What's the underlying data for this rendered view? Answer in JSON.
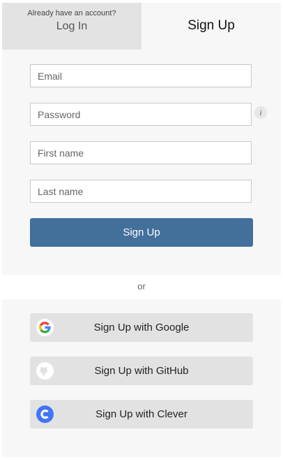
{
  "tabs": {
    "login_prompt": "Already have an account?",
    "login": "Log In",
    "signup": "Sign Up"
  },
  "form": {
    "email_placeholder": "Email",
    "password_placeholder": "Password",
    "first_name_placeholder": "First name",
    "last_name_placeholder": "Last name",
    "info_icon": "i",
    "submit": "Sign Up"
  },
  "divider": "or",
  "social": [
    {
      "label": "Sign Up with Google",
      "icon": "google-icon"
    },
    {
      "label": "Sign Up with GitHub",
      "icon": "github-icon"
    },
    {
      "label": "Sign Up with Clever",
      "icon": "clever-icon"
    }
  ],
  "colors": {
    "primary": "#436f9b",
    "clever": "#4274f6"
  }
}
